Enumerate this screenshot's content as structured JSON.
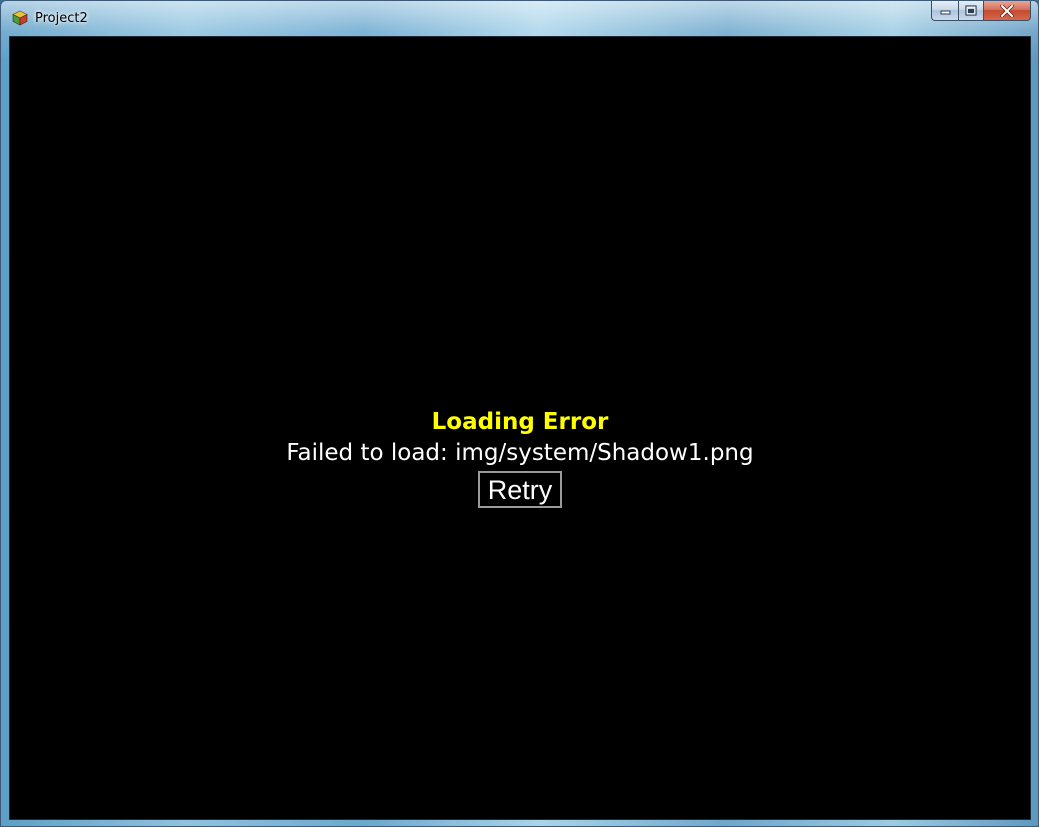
{
  "window": {
    "title": "Project2",
    "app_icon": "rpg-maker-cube-icon",
    "caption_buttons": {
      "minimize_icon": "minimize-icon",
      "maximize_icon": "maximize-icon",
      "close_icon": "close-icon"
    }
  },
  "error": {
    "title": "Loading Error",
    "message": "Failed to load: img/system/Shadow1.png",
    "retry_label": "Retry"
  },
  "colors": {
    "error_title": "#ffff00",
    "error_message": "#ffffff",
    "background": "#000000",
    "retry_border": "#9a9a9a"
  }
}
